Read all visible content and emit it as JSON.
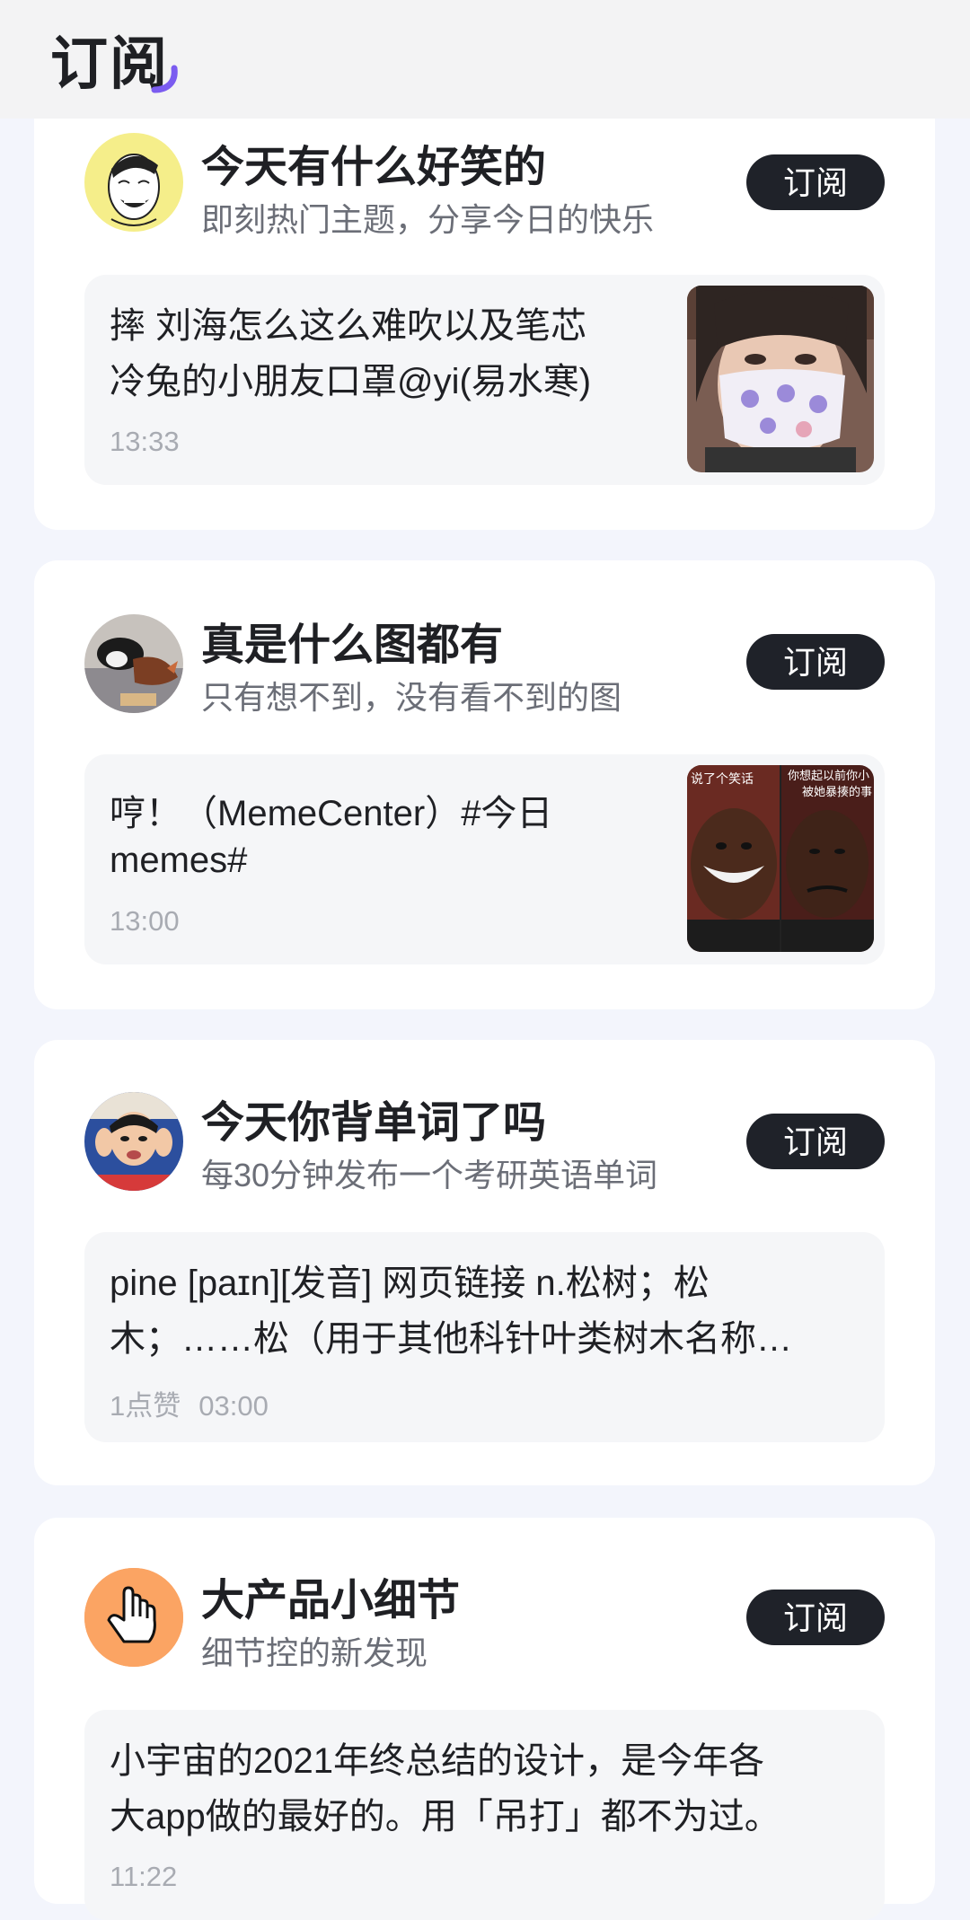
{
  "header": {
    "title": "订阅"
  },
  "cards": [
    {
      "title": "今天有什么好笑的",
      "subtitle": "即刻热门主题，分享今日的快乐",
      "button": "订阅",
      "post": {
        "line1": "摔 刘海怎么这么难吹以及笔芯",
        "line2": "冷兔的小朋友口罩@yi(易水寒)",
        "time": "13:33"
      }
    },
    {
      "title": "真是什么图都有",
      "subtitle": "只有想不到，没有看不到的图",
      "button": "订阅",
      "post": {
        "line1": "哼！（MemeCenter）#今日",
        "line2": "memes#",
        "time": "13:00",
        "thumb_caption_left": "说了个笑话",
        "thumb_caption_right": "你想起以前你小",
        "thumb_caption_right2": "被她暴揍的事"
      }
    },
    {
      "title": "今天你背单词了吗",
      "subtitle": "每30分钟发布一个考研英语单词",
      "button": "订阅",
      "post": {
        "line1": "pine  [paɪn][发音] 网页链接 n.松树；松",
        "line2": "木；……松（用于其他科针叶类树木名称…",
        "likes": "1点赞",
        "time": "03:00"
      }
    },
    {
      "title": "大产品小细节",
      "subtitle": "细节控的新发现",
      "button": "订阅",
      "post": {
        "line1": "小宇宙的2021年终总结的设计，是今年各",
        "line2": "大app做的最好的。用「吊打」都不为过。",
        "time": "11:22"
      }
    }
  ],
  "colors": {
    "accent": "#7b5cf0",
    "button_bg": "#1f2229",
    "card_bg": "#ffffff",
    "post_bg": "#f5f6f8"
  },
  "icons": [
    "rage-face-avatar",
    "cat-avatar",
    "boy-avatar",
    "hand-cursor-icon"
  ]
}
